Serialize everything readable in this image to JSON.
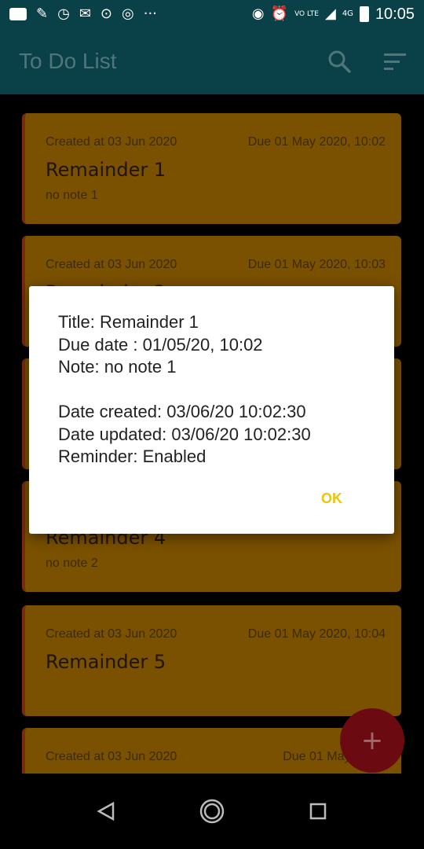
{
  "status_bar": {
    "time": "10:05",
    "icons_left": [
      "youtube-icon",
      "pen-icon",
      "clock-icon",
      "gmail-icon",
      "tripadvisor-icon",
      "swirl-icon",
      "more-dots-icon"
    ],
    "icons_right": [
      "hotspot-icon",
      "alarm-icon",
      "volte-icon",
      "signal-icon",
      "4g-signal-icon",
      "battery-icon"
    ],
    "network_label": "4G",
    "volte_label": "VO LTE",
    "more_glyph": "···"
  },
  "app_bar": {
    "title": "To Do List",
    "actions": [
      "search-icon",
      "sort-icon"
    ]
  },
  "tasks": [
    {
      "created": "Created at 03 Jun 2020",
      "due": "Due 01 May 2020, 10:02",
      "title": "Remainder 1",
      "note": "no note 1"
    },
    {
      "created": "Created at 03 Jun 2020",
      "due": "Due 01 May 2020, 10:03",
      "title": "Remainder 2",
      "note": ""
    },
    {
      "created": "",
      "due": "",
      "title": "",
      "note": ""
    },
    {
      "created": "",
      "due": "",
      "title": "Remainder 4",
      "note": "no note 2"
    },
    {
      "created": "Created at 03 Jun 2020",
      "due": "Due 01 May 2020, 10:04",
      "title": "Remainder 5",
      "note": ""
    },
    {
      "created": "Created at 03 Jun 2020",
      "due": "Due 01 May 2020,",
      "title": "",
      "note": ""
    }
  ],
  "fab": {
    "glyph": "+"
  },
  "dialog": {
    "line1": "Title: Remainder 1",
    "line2": "Due date : 01/05/20, 10:02",
    "line3": "Note: no note 1",
    "line4": "Date created: 03/06/20 10:02:30",
    "line5": "Date updated: 03/06/20 10:02:30",
    "line6": "Reminder: Enabled",
    "ok_label": "OK"
  },
  "colors": {
    "app_bar": "#0a4048",
    "card": "#7a5100",
    "card_stripe": "#7a2a10",
    "fab": "#6b0a10",
    "ok": "#f0c400"
  }
}
